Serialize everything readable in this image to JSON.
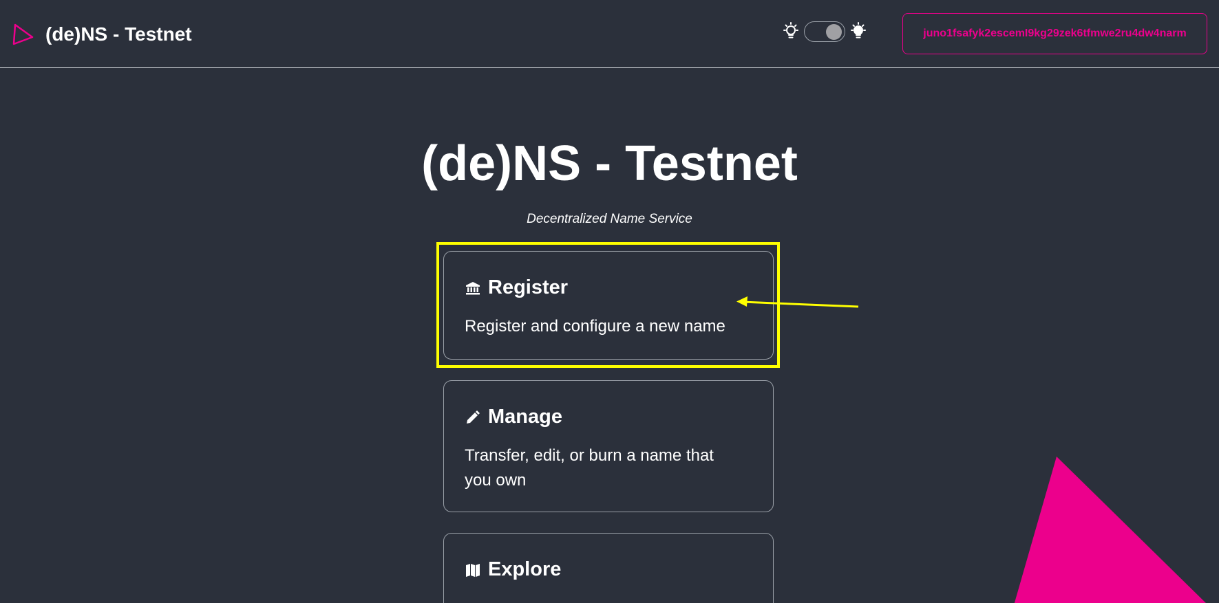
{
  "navbar": {
    "brand_name": "(de)NS - Testnet",
    "logo_icon": "triangle-logo-icon",
    "theme_toggle": {
      "left_icon": "lightbulb-outline-icon",
      "right_icon": "lightbulb-filled-icon",
      "state": "on"
    },
    "wallet_address": "juno1fsafyk2escemI9kg29zek6tfmwe2ru4dw4narm"
  },
  "hero": {
    "title": "(de)NS - Testnet",
    "subtitle": "Decentralized Name Service"
  },
  "cards": [
    {
      "icon": "bank-icon",
      "title": "Register",
      "description": "Register and configure a new name"
    },
    {
      "icon": "pencil-icon",
      "title": "Manage",
      "description": "Transfer, edit, or burn a name that you own"
    },
    {
      "icon": "map-icon",
      "title": "Explore",
      "description": ""
    }
  ],
  "colors": {
    "background": "#2b303b",
    "accent": "#ec008c",
    "annotation": "#ffff00",
    "text": "#ffffff",
    "border": "#9aa0a8"
  }
}
